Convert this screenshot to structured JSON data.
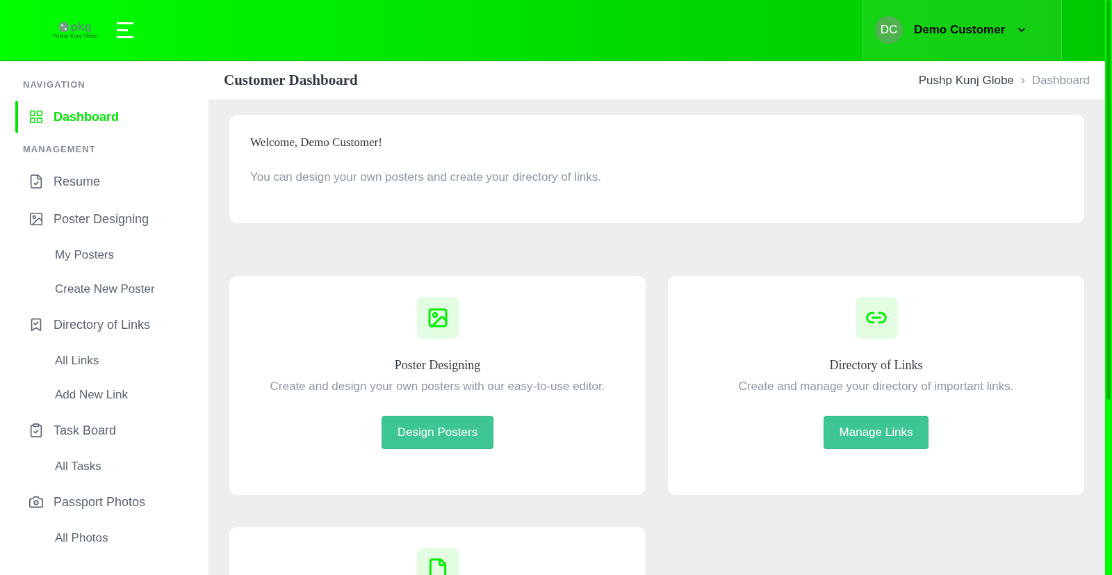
{
  "header": {
    "logo": {
      "mark": "pkg",
      "subtitle": "Pushp Kunj Globe"
    },
    "user": {
      "initials": "DC",
      "name": "Demo Customer"
    }
  },
  "sidebar": {
    "items": [
      {
        "kind": "section",
        "label": "NAVIGATION"
      },
      {
        "kind": "item",
        "label": "Dashboard",
        "selected": true
      },
      {
        "kind": "section",
        "label": "MANAGEMENT"
      },
      {
        "kind": "item",
        "label": "Resume",
        "selected": false
      },
      {
        "kind": "item",
        "label": "Poster Designing",
        "selected": false
      },
      {
        "kind": "sub",
        "label": "My Posters",
        "selected": false
      },
      {
        "kind": "sub",
        "label": "Create New Poster",
        "selected": false
      },
      {
        "kind": "item",
        "label": "Directory of Links",
        "selected": false
      },
      {
        "kind": "sub",
        "label": "All Links",
        "selected": false
      },
      {
        "kind": "sub",
        "label": "Add New Link",
        "selected": false
      },
      {
        "kind": "item",
        "label": "Task Board",
        "selected": false
      },
      {
        "kind": "sub",
        "label": "All Tasks",
        "selected": false
      },
      {
        "kind": "item",
        "label": "Passport Photos",
        "selected": false
      },
      {
        "kind": "sub",
        "label": "All Photos",
        "selected": false
      }
    ]
  },
  "page": {
    "title": "Customer Dashboard",
    "breadcrumb": [
      "Pushp Kunj Globe",
      "Dashboard"
    ]
  },
  "welcome": {
    "heading": "Welcome, Demo Customer!",
    "text": "You can design your own posters and create your directory of links."
  },
  "cards": [
    {
      "kind": "image",
      "title": "Poster Designing",
      "text": "Create and design your own posters with our easy-to-use editor.",
      "button": "Design Posters"
    },
    {
      "kind": "link",
      "title": "Directory of Links",
      "text": "Create and manage your directory of important links.",
      "button": "Manage Links"
    },
    {
      "kind": "document"
    }
  ]
}
